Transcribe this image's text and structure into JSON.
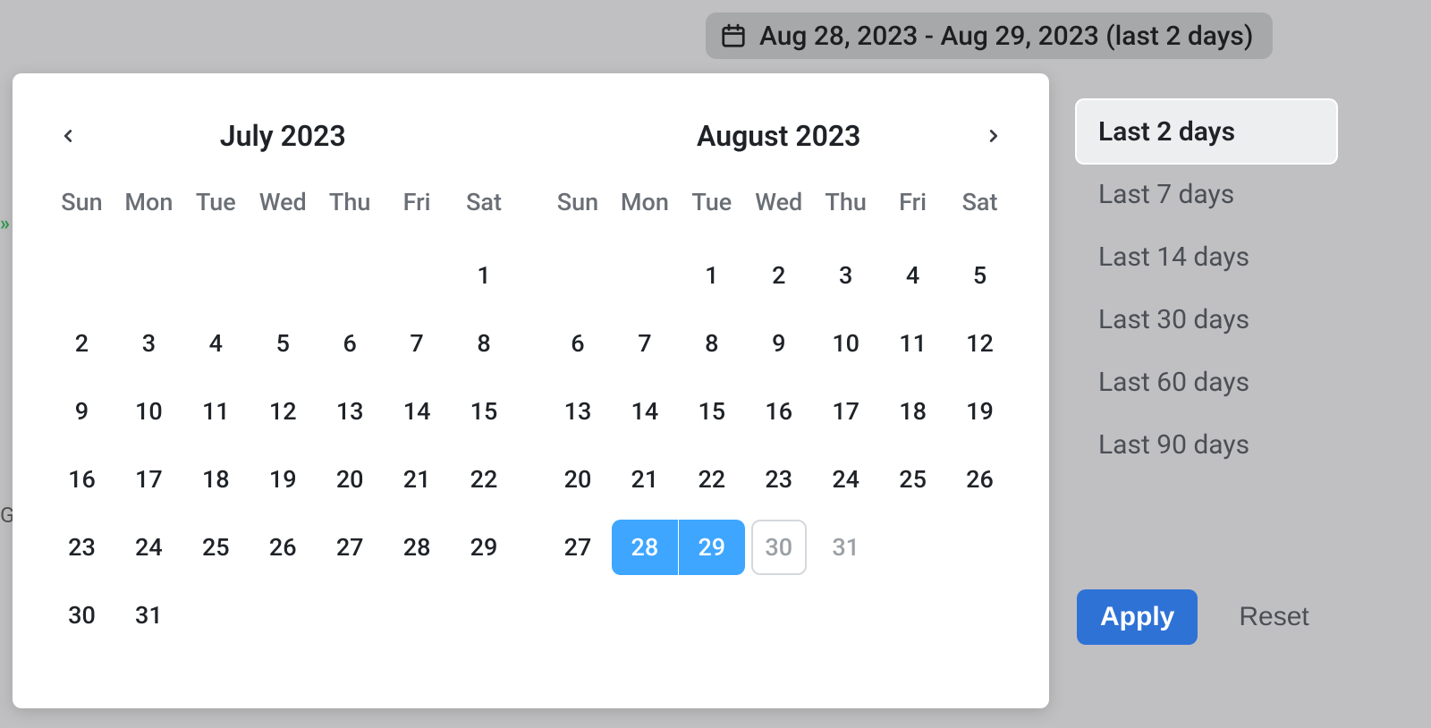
{
  "trigger": {
    "label": "Aug 28, 2023 - Aug 29, 2023 (last 2 days)"
  },
  "calendar": {
    "weekdays": [
      "Sun",
      "Mon",
      "Tue",
      "Wed",
      "Thu",
      "Fri",
      "Sat"
    ],
    "months": [
      {
        "title": "July 2023",
        "leading_blanks": 6,
        "days": 31,
        "selected": [],
        "today": null,
        "disabled": []
      },
      {
        "title": "August 2023",
        "leading_blanks": 2,
        "days": 31,
        "selected": [
          28,
          29
        ],
        "today": 30,
        "disabled": [
          30,
          31
        ]
      }
    ]
  },
  "presets": {
    "items": [
      "Last 2 days",
      "Last 7 days",
      "Last 14 days",
      "Last 30 days",
      "Last 60 days",
      "Last 90 days"
    ],
    "selected_index": 0
  },
  "actions": {
    "apply": "Apply",
    "reset": "Reset"
  },
  "colors": {
    "selection": "#3ea6ff",
    "primary_button": "#2f72d6"
  }
}
